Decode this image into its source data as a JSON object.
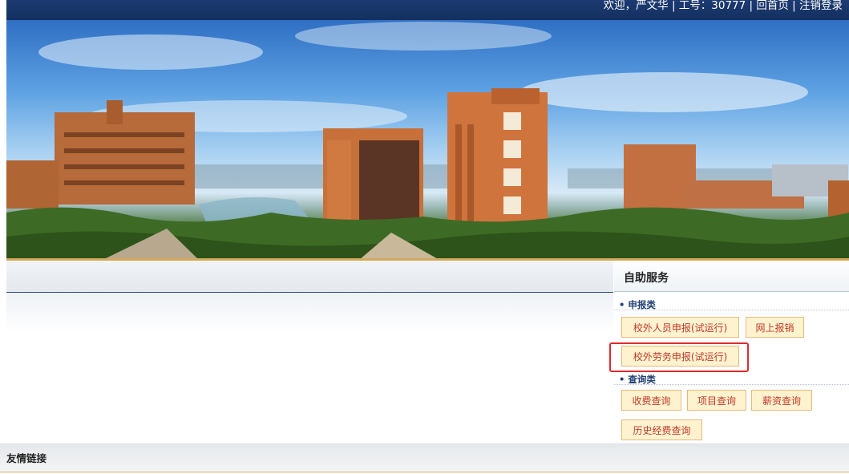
{
  "header": {
    "welcome_text": "欢迎，严文华 | 工号：30777 | 回首页 | 注销登录"
  },
  "sidebar": {
    "title": "自助服务",
    "sections": [
      {
        "label": "• 申报类",
        "buttons": [
          "校外人员申报(试运行)",
          "网上报销",
          "校外劳务申报(试运行)"
        ]
      },
      {
        "label": "• 查询类",
        "buttons": [
          "收费查询",
          "项目查询",
          "薪资查询",
          "历史经费查询"
        ]
      }
    ]
  },
  "footer": {
    "title": "友情链接"
  },
  "colors": {
    "topbar": "#1c3a72",
    "button_bg": "#fff3cf",
    "button_border": "#e5b97a",
    "button_text": "#c0392b",
    "highlight": "#e0292d",
    "section_label": "#1f3f72"
  }
}
